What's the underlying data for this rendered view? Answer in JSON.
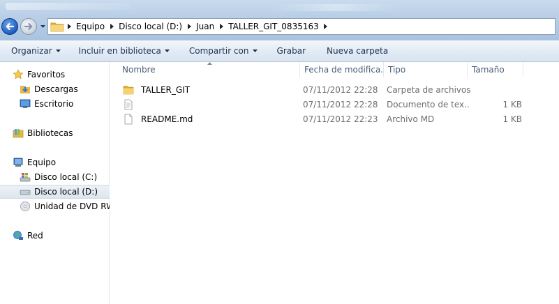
{
  "address": {
    "crumbs": [
      "Equipo",
      "Disco local (D:)",
      "Juan",
      "TALLER_GIT_0835163"
    ]
  },
  "toolbar": {
    "organize": "Organizar",
    "include_library": "Incluir en biblioteca",
    "share": "Compartir con",
    "burn": "Grabar",
    "new_folder": "Nueva carpeta"
  },
  "sidebar": {
    "favorites": "Favoritos",
    "downloads": "Descargas",
    "desktop": "Escritorio",
    "libraries": "Bibliotecas",
    "computer": "Equipo",
    "disk_c": "Disco local (C:)",
    "disk_d": "Disco local (D:)",
    "dvd": "Unidad de DVD RW (",
    "network": "Red"
  },
  "columns": {
    "name": "Nombre",
    "date": "Fecha de modifica...",
    "type": "Tipo",
    "size": "Tamaño"
  },
  "files": [
    {
      "name": "TALLER_GIT",
      "date": "07/11/2012 22:28",
      "type": "Carpeta de archivos",
      "size": "",
      "icon": "folder-icon"
    },
    {
      "name": "",
      "date": "07/11/2012 22:28",
      "type": "Documento de tex...",
      "size": "1 KB",
      "icon": "text-file-icon"
    },
    {
      "name": "README.md",
      "date": "07/11/2012 22:23",
      "type": "Archivo MD",
      "size": "1 KB",
      "icon": "file-icon"
    }
  ],
  "colors": {
    "selection": "#dde5ef",
    "header_text": "#4c607a",
    "toolbar_text": "#1e3250"
  }
}
